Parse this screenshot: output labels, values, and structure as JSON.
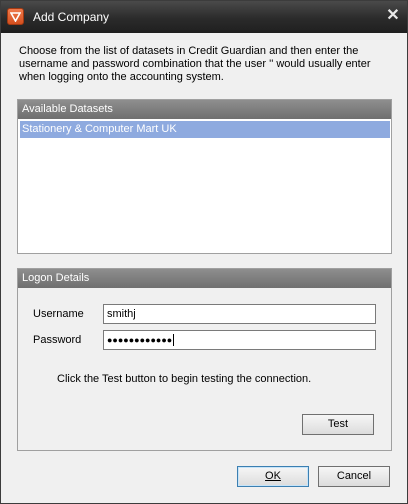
{
  "window": {
    "title": "Add Company",
    "app_icon": "credit-guardian-app-icon",
    "close_glyph": "✕"
  },
  "intro_text": "Choose from the list of datasets in Credit Guardian and then enter the username and password combination that the user '' would usually enter when logging onto the accounting system.",
  "datasets": {
    "header": "Available Datasets",
    "items": [
      "Stationery & Computer Mart UK"
    ],
    "selected_index": 0
  },
  "logon": {
    "header": "Logon Details",
    "username_label": "Username",
    "username_value": "smithj",
    "password_label": "Password",
    "password_value": "●●●●●●●●●●●●",
    "hint": "Click the Test button to begin testing the connection.",
    "test_label": "Test"
  },
  "footer": {
    "ok_label": "OK",
    "cancel_label": "Cancel"
  },
  "colors": {
    "titlebar": "#2b2b2b",
    "selection": "#8eaadf",
    "group_header": "#7f7f7f"
  }
}
